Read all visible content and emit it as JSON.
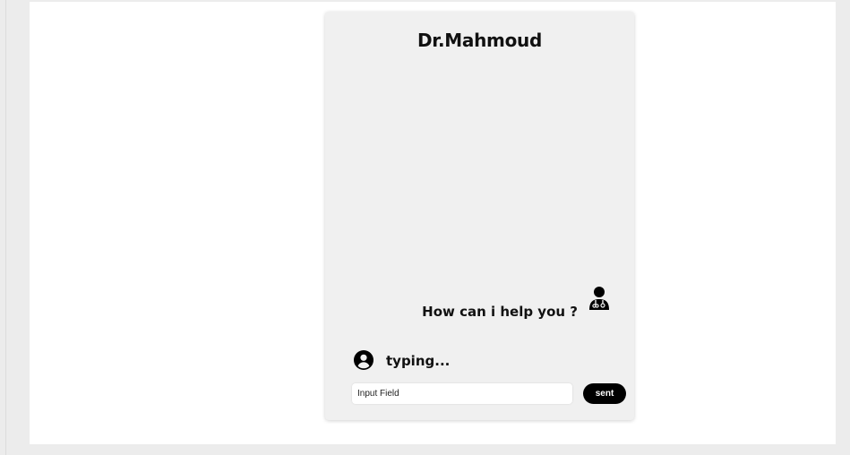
{
  "chat": {
    "title": "Dr.Mahmoud",
    "bot_message": "How can i help you ?",
    "typing_status": "typing...",
    "input_placeholder": "Input Field",
    "send_label": "sent"
  },
  "icons": {
    "doctor": "doctor-avatar-icon",
    "user": "user-account-circle-icon"
  },
  "colors": {
    "page_background": "#ececec",
    "canvas": "#ffffff",
    "card": "#f0f0f0",
    "text": "#111111",
    "button": "#000000",
    "button_text": "#ffffff"
  }
}
